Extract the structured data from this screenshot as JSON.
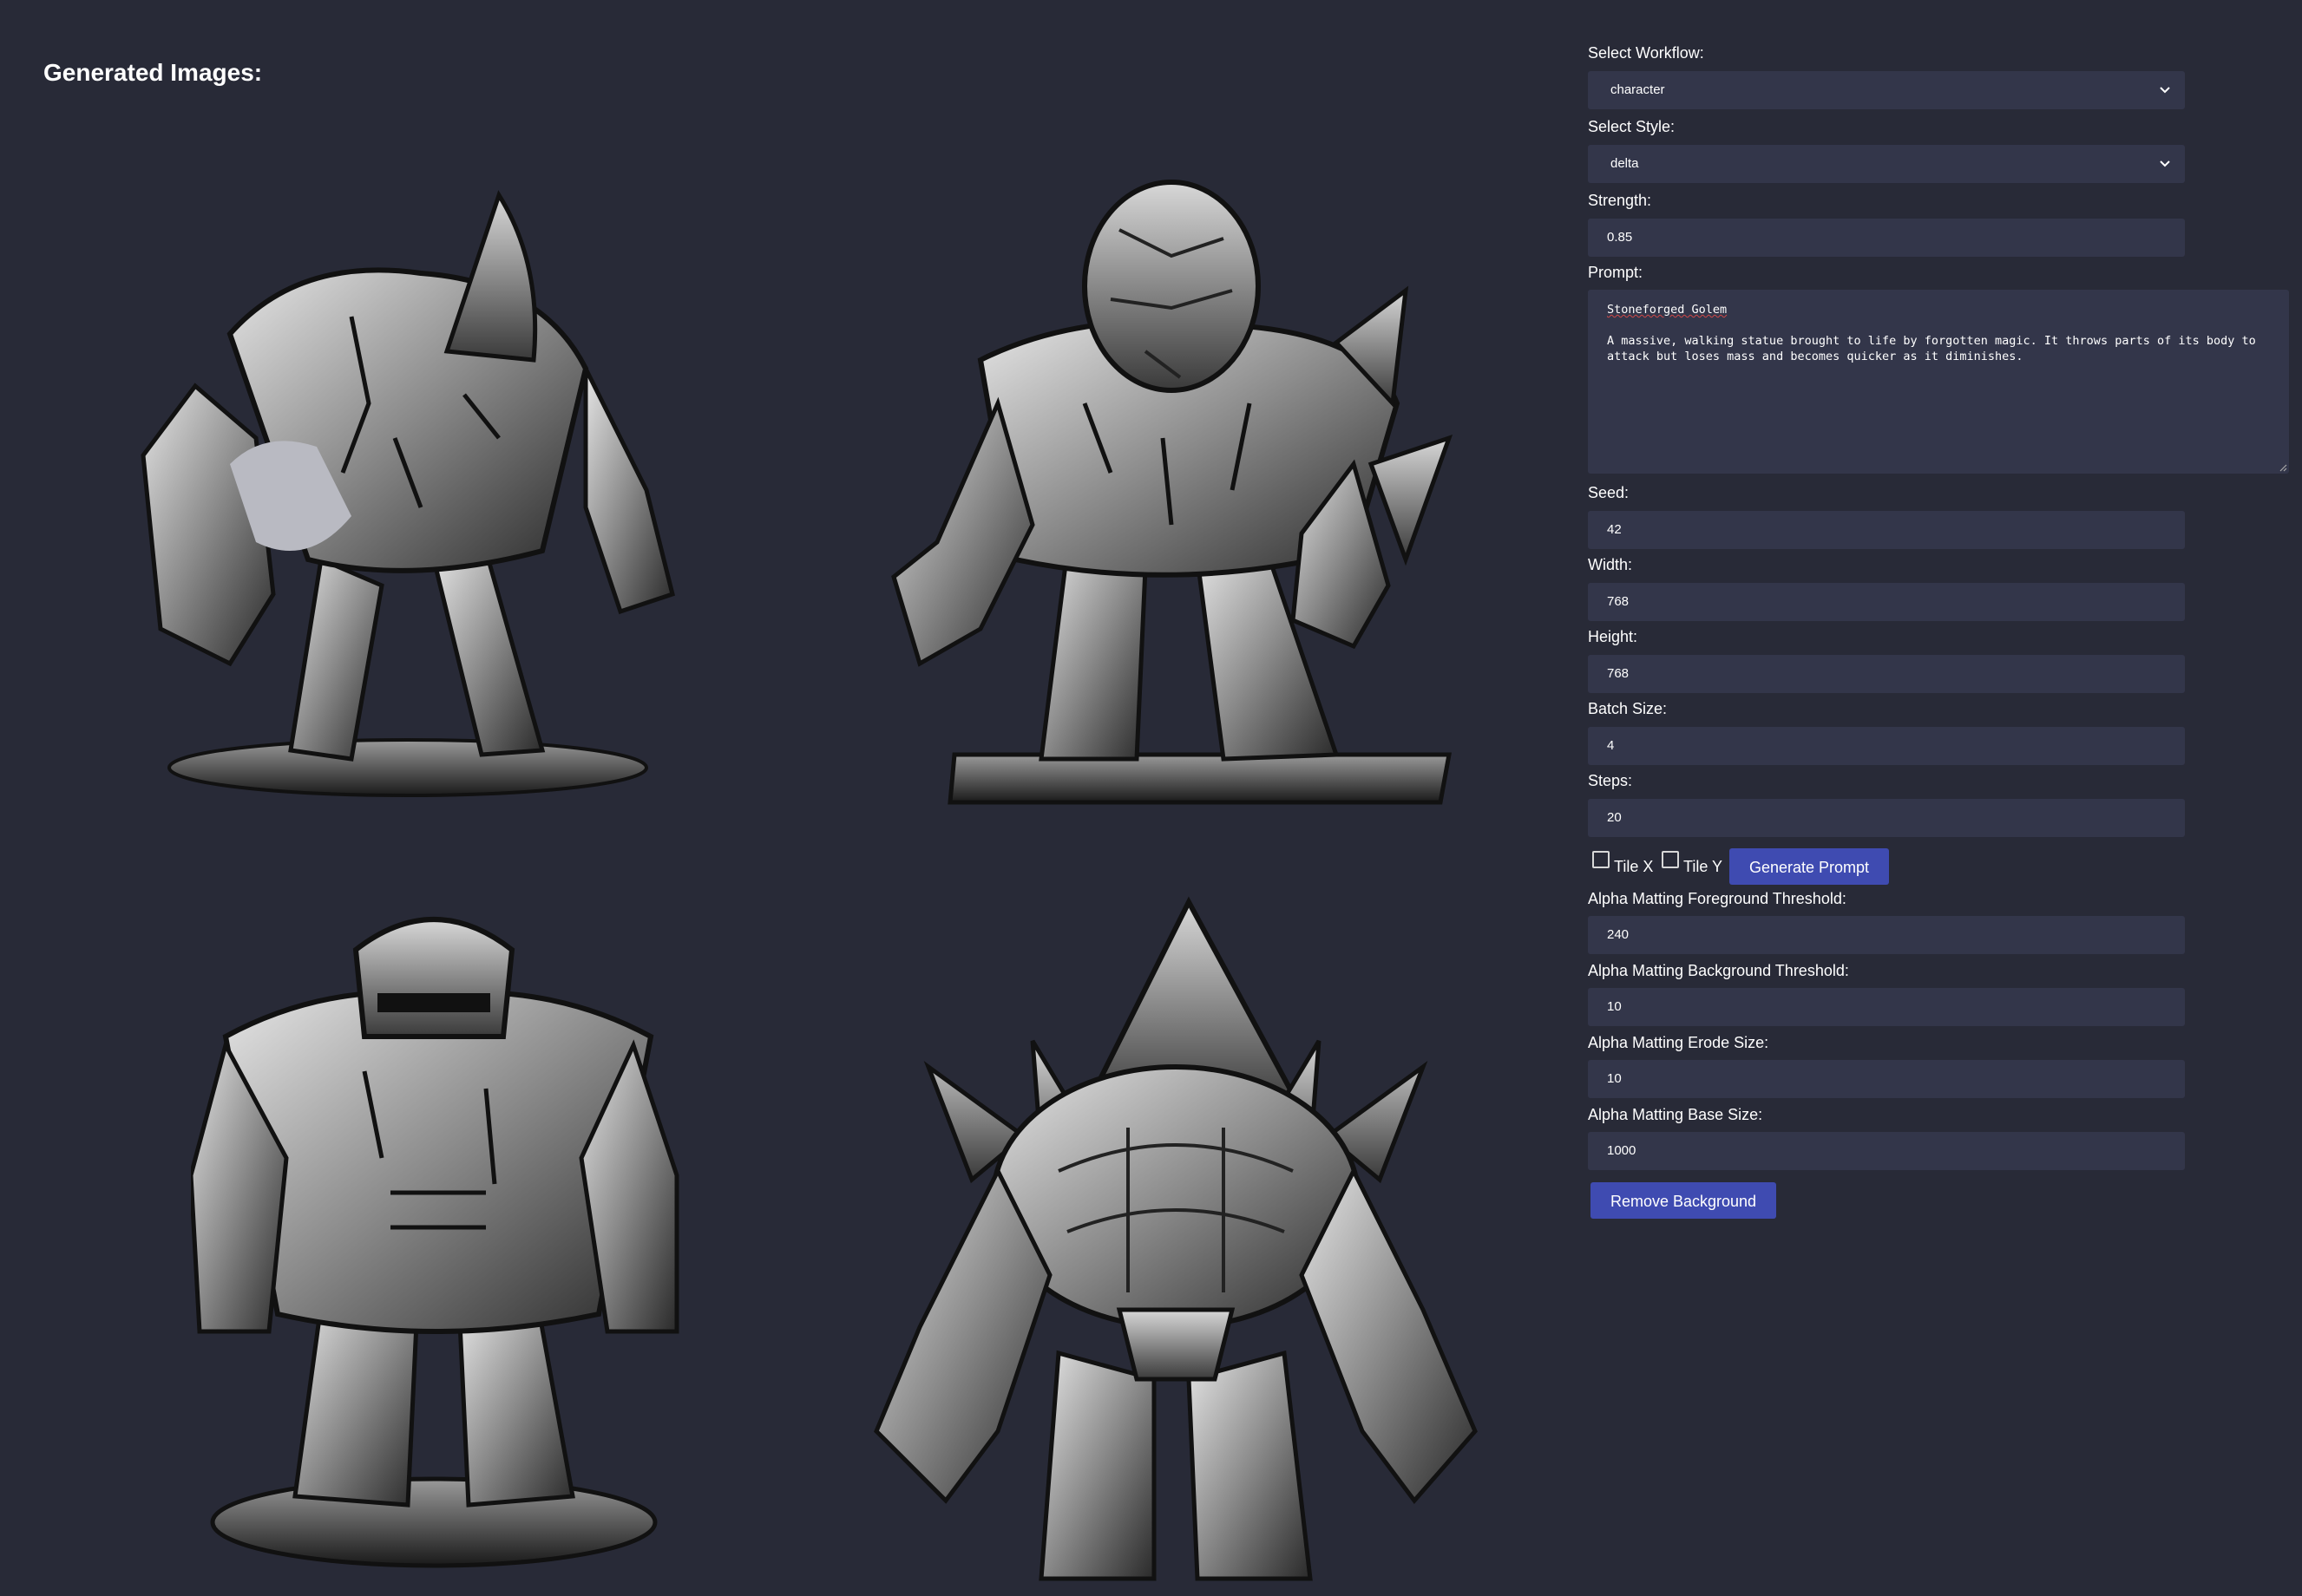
{
  "gallery": {
    "heading": "Generated Images:",
    "images": [
      {
        "subject": "stone golem hunched with grey blob patch"
      },
      {
        "subject": "stone golem with egg-shaped cracked head"
      },
      {
        "subject": "stone golem with visor head on round base"
      },
      {
        "subject": "stone golem with spiked shell crown"
      }
    ]
  },
  "form": {
    "workflow": {
      "label": "Select Workflow:",
      "value": "character"
    },
    "style": {
      "label": "Select Style:",
      "value": "delta"
    },
    "strength": {
      "label": "Strength:",
      "value": "0.85"
    },
    "prompt": {
      "label": "Prompt:",
      "title": "Stoneforged Golem",
      "body_line1": "A massive, walking statue brought to life by forgotten magic. It throws parts of its body to",
      "body_line2": "attack but loses mass and becomes quicker as it diminishes."
    },
    "seed": {
      "label": "Seed:",
      "value": "42"
    },
    "width": {
      "label": "Width:",
      "value": "768"
    },
    "height": {
      "label": "Height:",
      "value": "768"
    },
    "batch_size": {
      "label": "Batch Size:",
      "value": "4"
    },
    "steps": {
      "label": "Steps:",
      "value": "20"
    },
    "tile_x": {
      "label": "Tile X",
      "checked": false
    },
    "tile_y": {
      "label": "Tile Y",
      "checked": false
    },
    "generate_prompt_label": "Generate Prompt",
    "fg_threshold": {
      "label": "Alpha Matting Foreground Threshold:",
      "value": "240"
    },
    "bg_threshold": {
      "label": "Alpha Matting Background Threshold:",
      "value": "10"
    },
    "erode_size": {
      "label": "Alpha Matting Erode Size:",
      "value": "10"
    },
    "base_size": {
      "label": "Alpha Matting Base Size:",
      "value": "1000"
    },
    "remove_background_label": "Remove Background"
  },
  "colors": {
    "background": "#282a37",
    "field": "#33364a",
    "button": "#3f4bb1"
  }
}
